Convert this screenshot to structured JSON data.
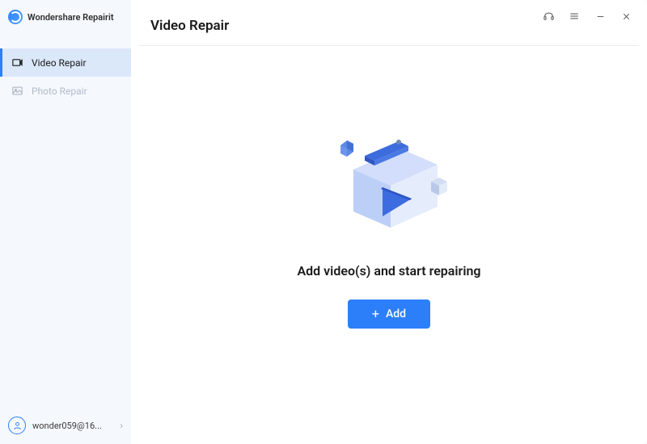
{
  "app": {
    "name": "Wondershare Repairit"
  },
  "sidebar": {
    "items": [
      {
        "label": "Video Repair",
        "active": true
      },
      {
        "label": "Photo Repair",
        "active": false
      }
    ]
  },
  "user": {
    "name": "wonder059@16..."
  },
  "page": {
    "title": "Video Repair",
    "prompt": "Add video(s) and start repairing",
    "add_button": "Add"
  },
  "colors": {
    "accent": "#2d7ff9",
    "sidebar_bg": "#f5f8fd",
    "sidebar_active": "#dbe8fa"
  }
}
